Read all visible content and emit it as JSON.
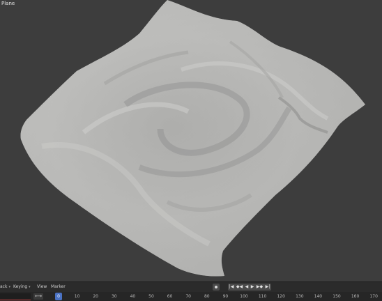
{
  "viewport": {
    "object_name": "Plane"
  },
  "timeline": {
    "menus": {
      "playback": "ack",
      "keying": "Keying",
      "view": "View",
      "marker": "Marker"
    },
    "controls": {
      "jump_start": "|◀",
      "prev_key": "◆◀",
      "play_reverse": "◀",
      "play": "▶",
      "next_key": "▶◆",
      "jump_end": "▶|"
    },
    "range_toggle": "⟷",
    "current_frame": "0",
    "ticks": [
      "10",
      "20",
      "30",
      "40",
      "50",
      "60",
      "70",
      "80",
      "90",
      "100",
      "110",
      "120",
      "130",
      "140",
      "150",
      "160",
      "170"
    ]
  },
  "colors": {
    "background": "#3d3d3d",
    "cloth": "#b4b4b2",
    "current_frame": "#4a72c4"
  }
}
